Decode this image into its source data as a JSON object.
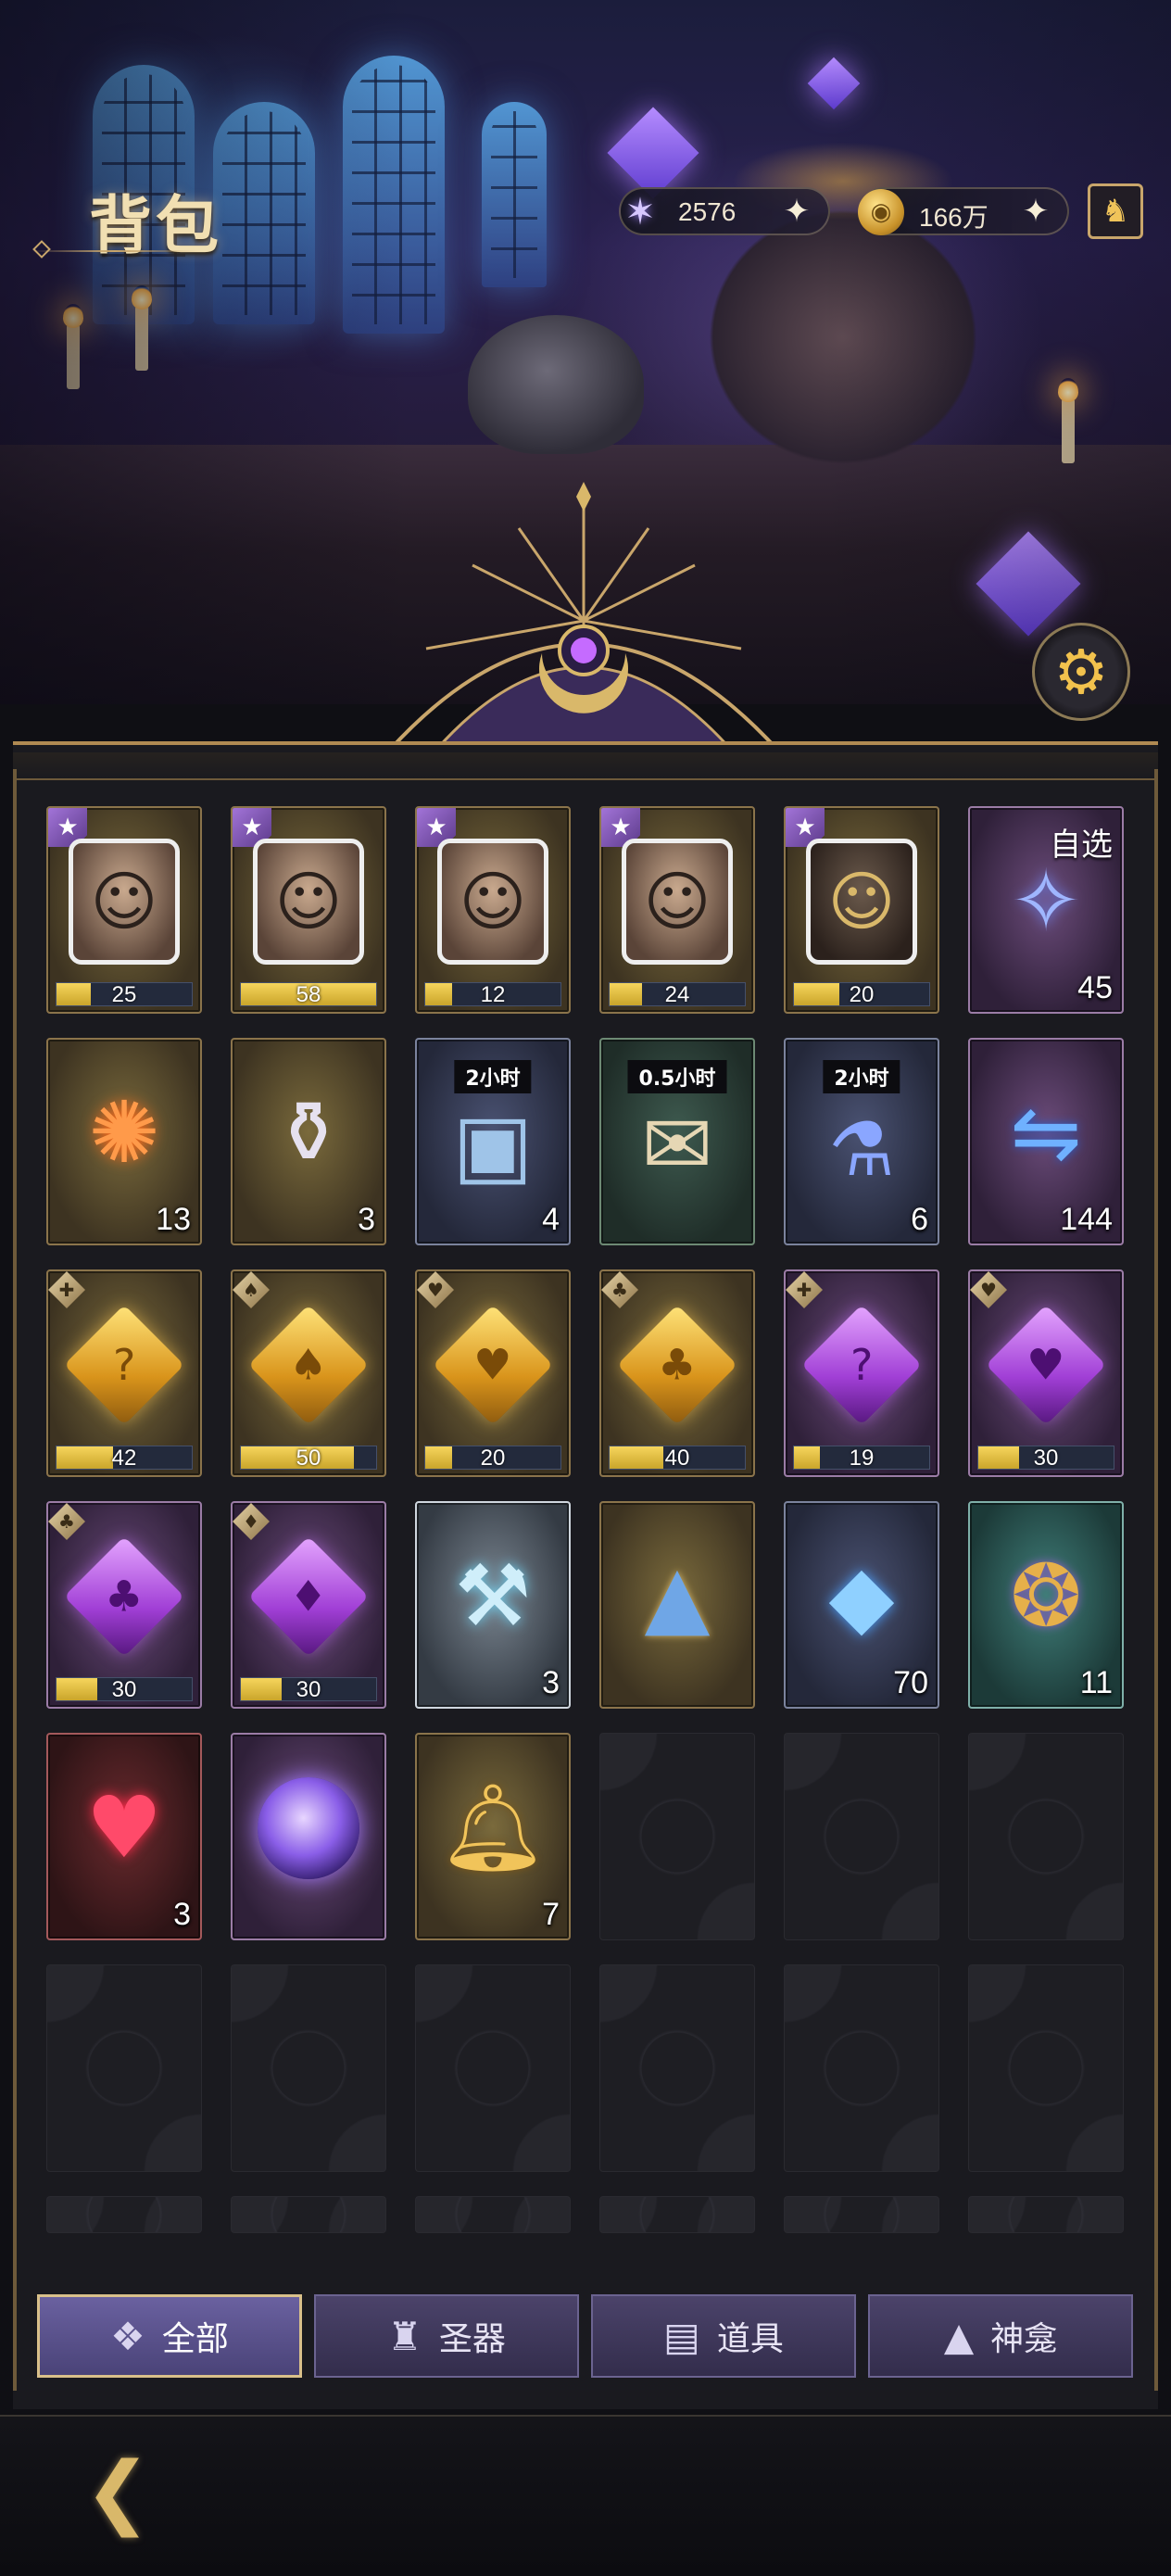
{
  "header": {
    "title": "背包"
  },
  "currencies": [
    {
      "icon": "star-crystal-icon",
      "value": "2576"
    },
    {
      "icon": "gold-coin-icon",
      "value": "166万"
    }
  ],
  "inventory": [
    {
      "icon": "hero-puzzle-icon",
      "star": "★",
      "progress": 25,
      "progress_max": 100,
      "label": "25"
    },
    {
      "icon": "hero-puzzle-icon",
      "star": "★",
      "progress": 58,
      "progress_max": 58,
      "label": "58"
    },
    {
      "icon": "hero-puzzle-icon",
      "star": "★",
      "progress": 12,
      "progress_max": 60,
      "label": "12"
    },
    {
      "icon": "hero-puzzle-icon",
      "star": "★",
      "progress": 24,
      "progress_max": 100,
      "label": "24"
    },
    {
      "icon": "hero-puzzle-icon",
      "star": "★",
      "progress": 20,
      "progress_max": 60,
      "label": "20"
    },
    {
      "icon": "selectable-card-icon",
      "tag": "自选",
      "count": "45"
    },
    {
      "icon": "fireworks-icon",
      "count": "13"
    },
    {
      "icon": "potion-flask-icon",
      "count": "3"
    },
    {
      "icon": "treasure-chest-icon",
      "time": "2小时",
      "count": "4"
    },
    {
      "icon": "scroll-icon",
      "time": "0.5小时",
      "count": ""
    },
    {
      "icon": "exp-potion-icon",
      "time": "2小时",
      "count": "6"
    },
    {
      "icon": "swap-token-icon",
      "count": "144"
    },
    {
      "icon": "gold-crystal-icon",
      "suit": "✚",
      "progress": 42,
      "progress_max": 100,
      "label": "42"
    },
    {
      "icon": "gold-crystal-icon",
      "suit": "♠",
      "progress": 50,
      "progress_max": 60,
      "label": "50"
    },
    {
      "icon": "gold-crystal-icon",
      "suit": "♥",
      "progress": 20,
      "progress_max": 100,
      "label": "20"
    },
    {
      "icon": "gold-crystal-icon",
      "suit": "♣",
      "progress": 40,
      "progress_max": 100,
      "label": "40"
    },
    {
      "icon": "purple-crystal-icon",
      "suit": "✚",
      "progress": 19,
      "progress_max": 100,
      "label": "19"
    },
    {
      "icon": "purple-crystal-icon",
      "suit": "♥",
      "progress": 30,
      "progress_max": 100,
      "label": "30"
    },
    {
      "icon": "purple-crystal-icon",
      "suit": "♣",
      "progress": 30,
      "progress_max": 100,
      "label": "30"
    },
    {
      "icon": "purple-crystal-icon",
      "suit": "♦",
      "progress": 30,
      "progress_max": 100,
      "label": "30"
    },
    {
      "icon": "hammer-orb-icon",
      "count": "3"
    },
    {
      "icon": "triangle-rune-icon",
      "count": ""
    },
    {
      "icon": "blue-gem-icon",
      "count": "70"
    },
    {
      "icon": "ornate-amulet-icon",
      "count": "11"
    },
    {
      "icon": "ruby-pendant-icon",
      "count": "3"
    },
    {
      "icon": "magic-orb-icon",
      "count": ""
    },
    {
      "icon": "golden-bell-icon",
      "count": "7"
    }
  ],
  "tabs": [
    {
      "label": "全部",
      "icon": "all-icon",
      "active": true
    },
    {
      "label": "圣器",
      "icon": "relic-icon",
      "active": false
    },
    {
      "label": "道具",
      "icon": "items-icon",
      "active": false
    },
    {
      "label": "神龛",
      "icon": "shrine-icon",
      "active": false
    }
  ],
  "colors": {
    "accent_gold": "#c9a66b",
    "tab_active": "#6a61a0",
    "panel_bg": "#1a1a1f"
  }
}
